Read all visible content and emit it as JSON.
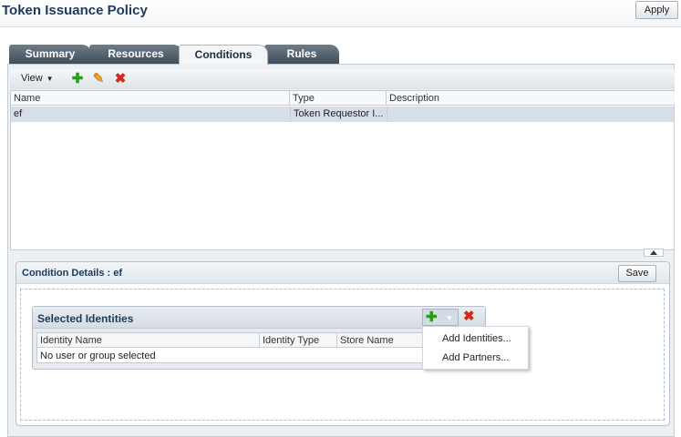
{
  "header": {
    "title": "Token Issuance Policy",
    "apply_label": "Apply"
  },
  "tabs": [
    {
      "label": "Summary",
      "active": false
    },
    {
      "label": "Resources",
      "active": false
    },
    {
      "label": "Conditions",
      "active": true
    },
    {
      "label": "Rules",
      "active": false
    }
  ],
  "toolbar": {
    "view_label": "View",
    "icons": [
      "add-icon",
      "edit-icon",
      "delete-icon"
    ]
  },
  "conditions_table": {
    "columns": [
      "Name",
      "Type",
      "Description"
    ],
    "rows": [
      {
        "name": "ef",
        "type": "Token Requestor I...",
        "description": "",
        "selected": true
      }
    ]
  },
  "condition_details": {
    "title": "Condition Details : ef",
    "save_label": "Save"
  },
  "selected_identities": {
    "title": "Selected Identities",
    "columns": [
      "Identity Name",
      "Identity Type",
      "Store Name"
    ],
    "empty_text": "No user or group selected"
  },
  "add_menu": {
    "items": [
      "Add Identities...",
      "Add Partners..."
    ]
  },
  "colors": {
    "tab_inactive": "#4b5866",
    "selected_row": "#d6dfe9",
    "add_green": "#2a9e1c",
    "delete_red": "#d12a1a",
    "title_blue": "#1d3a5c"
  }
}
